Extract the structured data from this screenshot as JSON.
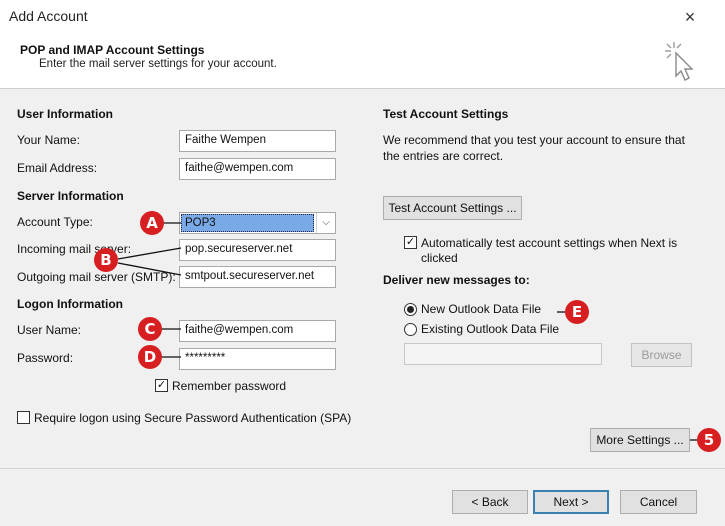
{
  "window": {
    "title": "Add Account",
    "close_icon": "×"
  },
  "header": {
    "title": "POP and IMAP Account Settings",
    "subtitle": "Enter the mail server settings for your account."
  },
  "user_info": {
    "heading": "User Information",
    "name_label": "Your Name:",
    "name_value": "Faithe Wempen",
    "email_label": "Email Address:",
    "email_value": "faithe@wempen.com"
  },
  "server_info": {
    "heading": "Server Information",
    "account_type_label": "Account Type:",
    "account_type_value": "POP3",
    "incoming_label": "Incoming mail server:",
    "incoming_value": "pop.secureserver.net",
    "outgoing_label": "Outgoing mail server (SMTP):",
    "outgoing_value": "smtpout.secureserver.net"
  },
  "logon_info": {
    "heading": "Logon Information",
    "username_label": "User Name:",
    "username_value": "faithe@wempen.com",
    "password_label": "Password:",
    "password_value": "*********",
    "remember_label": "Remember password",
    "remember_checked": true,
    "spa_label": "Require logon using Secure Password Authentication (SPA)",
    "spa_checked": false
  },
  "test_settings": {
    "heading": "Test Account Settings",
    "description_line1": "We recommend that you test your account to ensure that",
    "description_line2": "the entries are correct.",
    "test_button": "Test Account Settings ...",
    "auto_test_line1": "Automatically test account settings when Next is",
    "auto_test_line2": "clicked",
    "auto_test_checked": true
  },
  "deliver": {
    "heading": "Deliver new messages to:",
    "option_new": "New Outlook Data File",
    "option_existing": "Existing Outlook Data File",
    "selected": "new",
    "path_value": "",
    "browse_button": "Browse"
  },
  "more_settings_button": "More Settings ...",
  "footer": {
    "back_button": "< Back",
    "next_button": "Next >",
    "cancel_button": "Cancel"
  },
  "callouts": {
    "a": "A",
    "b": "B",
    "c": "C",
    "d": "D",
    "e": "E",
    "five": "5"
  },
  "colors": {
    "callout": "#d71f22",
    "selection": "#7aa9e8",
    "primary_border": "#3c7fb1"
  }
}
